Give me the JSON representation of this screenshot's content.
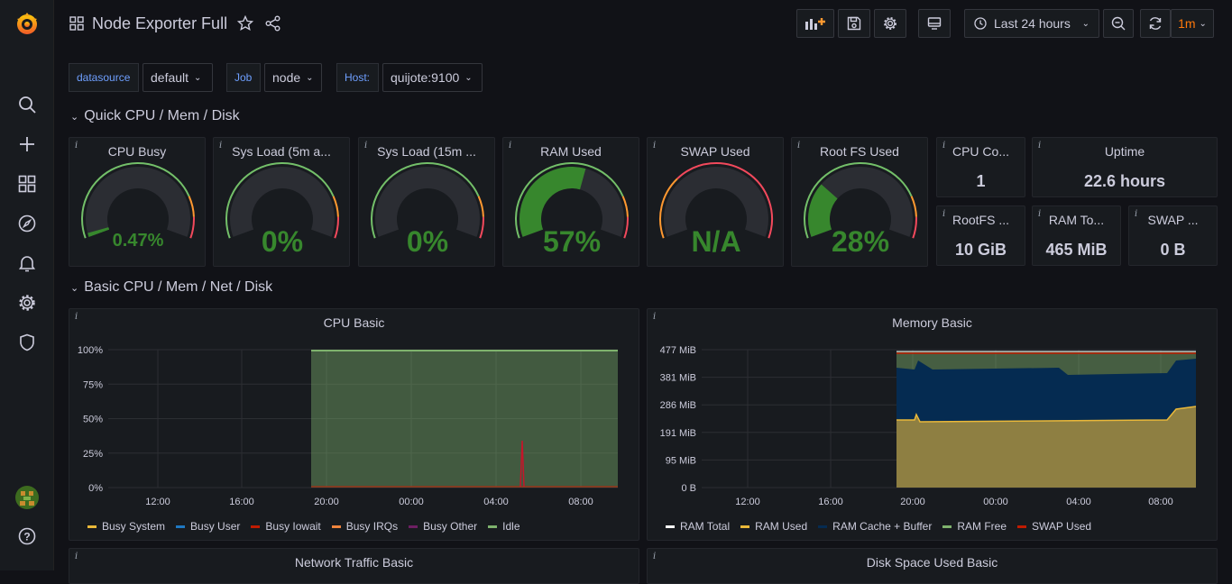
{
  "dashboard": {
    "title": "Node Exporter Full"
  },
  "toolbar": {
    "time_range": "Last 24 hours",
    "refresh": "1m"
  },
  "variables": [
    {
      "label": "datasource",
      "value": "default"
    },
    {
      "label": "Job",
      "value": "node"
    },
    {
      "label": "Host:",
      "value": "quijote:9100"
    }
  ],
  "rows": {
    "quick": "Quick CPU / Mem / Disk",
    "basic": "Basic CPU / Mem / Net / Disk"
  },
  "gauges": [
    {
      "title": "CPU Busy",
      "value": "0.47%",
      "fraction": 0.0047
    },
    {
      "title": "Sys Load (5m a...",
      "value": "0%",
      "fraction": 0
    },
    {
      "title": "Sys Load (15m ...",
      "value": "0%",
      "fraction": 0
    },
    {
      "title": "RAM Used",
      "value": "57%",
      "fraction": 0.57
    },
    {
      "title": "SWAP Used",
      "value": "N/A",
      "fraction": 0
    },
    {
      "title": "Root FS Used",
      "value": "28%",
      "fraction": 0.28
    }
  ],
  "stats": [
    {
      "title": "CPU Co...",
      "value": "1"
    },
    {
      "title": "Uptime",
      "value": "22.6 hours"
    },
    {
      "title": "RootFS ...",
      "value": "10 GiB"
    },
    {
      "title": "RAM To...",
      "value": "465 MiB"
    },
    {
      "title": "SWAP ...",
      "value": "0 B"
    }
  ],
  "panels": {
    "network": "Network Traffic Basic",
    "disk": "Disk Space Used Basic"
  },
  "colors": {
    "green": "#37872d",
    "ok": "#73bf69",
    "threshold_orange": "#ff9830",
    "threshold_red": "#f2495c",
    "accent_orange": "#ff780a"
  },
  "chart_data": [
    {
      "type": "area",
      "title": "CPU Basic",
      "x": [
        "12:00",
        "16:00",
        "20:00",
        "00:00",
        "04:00",
        "08:00"
      ],
      "y_ticks": [
        "100%",
        "75%",
        "50%",
        "25%",
        "0%"
      ],
      "ylim": [
        0,
        100
      ],
      "series": [
        {
          "name": "Busy System",
          "color": "#eab839"
        },
        {
          "name": "Busy User",
          "color": "#1f78c1"
        },
        {
          "name": "Busy Iowait",
          "color": "#bf1b00"
        },
        {
          "name": "Busy IRQs",
          "color": "#ef843c"
        },
        {
          "name": "Busy Other",
          "color": "#6d1f62"
        },
        {
          "name": "Idle",
          "color": "#7eb26d"
        }
      ],
      "legend": "bottom"
    },
    {
      "type": "area",
      "title": "Memory Basic",
      "x": [
        "12:00",
        "16:00",
        "20:00",
        "00:00",
        "04:00",
        "08:00"
      ],
      "y_ticks": [
        "477 MiB",
        "381 MiB",
        "286 MiB",
        "191 MiB",
        "95 MiB",
        "0 B"
      ],
      "series": [
        {
          "name": "RAM Total",
          "color": "#ffffff"
        },
        {
          "name": "RAM Used",
          "color": "#eab839"
        },
        {
          "name": "RAM Cache + Buffer",
          "color": "#052b51"
        },
        {
          "name": "RAM Free",
          "color": "#7eb26d"
        },
        {
          "name": "SWAP Used",
          "color": "#bf1b00"
        }
      ],
      "legend": "bottom"
    }
  ]
}
